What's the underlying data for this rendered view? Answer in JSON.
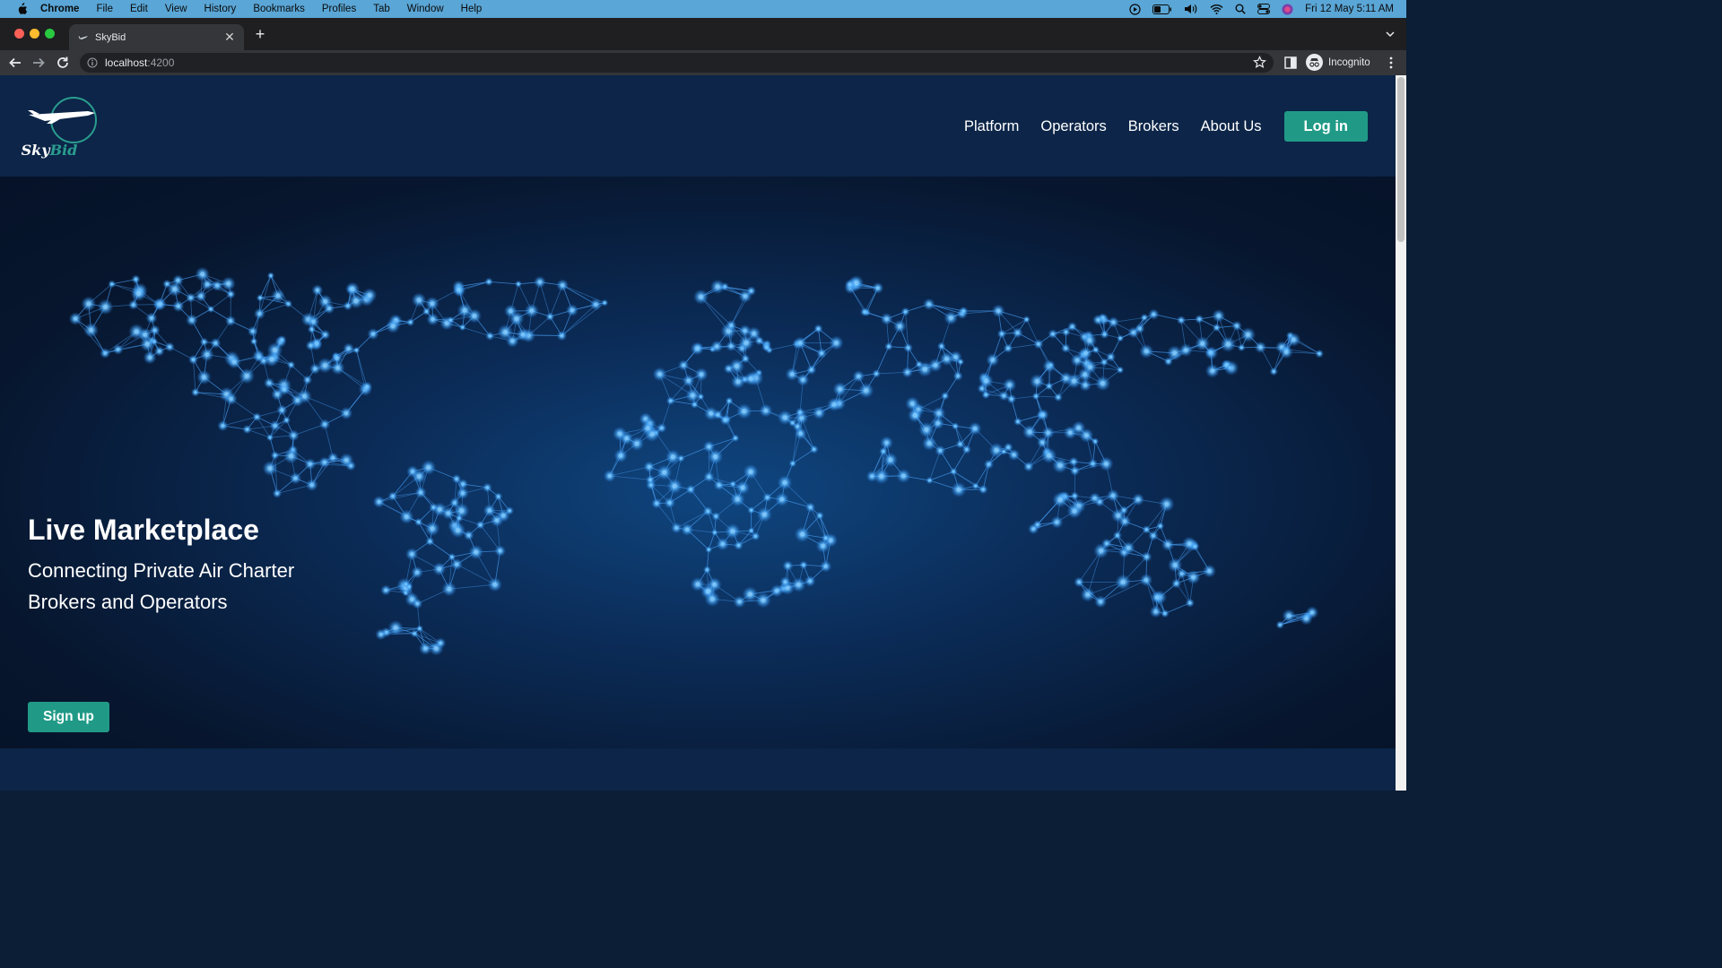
{
  "menubar": {
    "app": "Chrome",
    "items": [
      "File",
      "Edit",
      "View",
      "History",
      "Bookmarks",
      "Profiles",
      "Tab",
      "Window",
      "Help"
    ],
    "clock": "Fri 12 May  5:11 AM",
    "icons": [
      "apple-icon",
      "play-icon",
      "battery-icon",
      "volume-icon",
      "wifi-icon",
      "search-icon",
      "control-center-icon",
      "siri-icon"
    ]
  },
  "browser": {
    "tab_title": "SkyBid",
    "url_host": "localhost",
    "url_port": ":4200",
    "profile_label": "Incognito"
  },
  "site": {
    "brand_left": "Sky",
    "brand_right": "Bid",
    "nav": [
      "Platform",
      "Operators",
      "Brokers",
      "About Us"
    ],
    "login_label": "Log in",
    "colors": {
      "accent": "#209a87",
      "header": "#0c2548",
      "node": "#6fc3ff"
    }
  },
  "hero": {
    "title": "Live Marketplace",
    "subtitle": "Connecting Private Air Charter Brokers and Operators",
    "signup_label": "Sign up"
  }
}
